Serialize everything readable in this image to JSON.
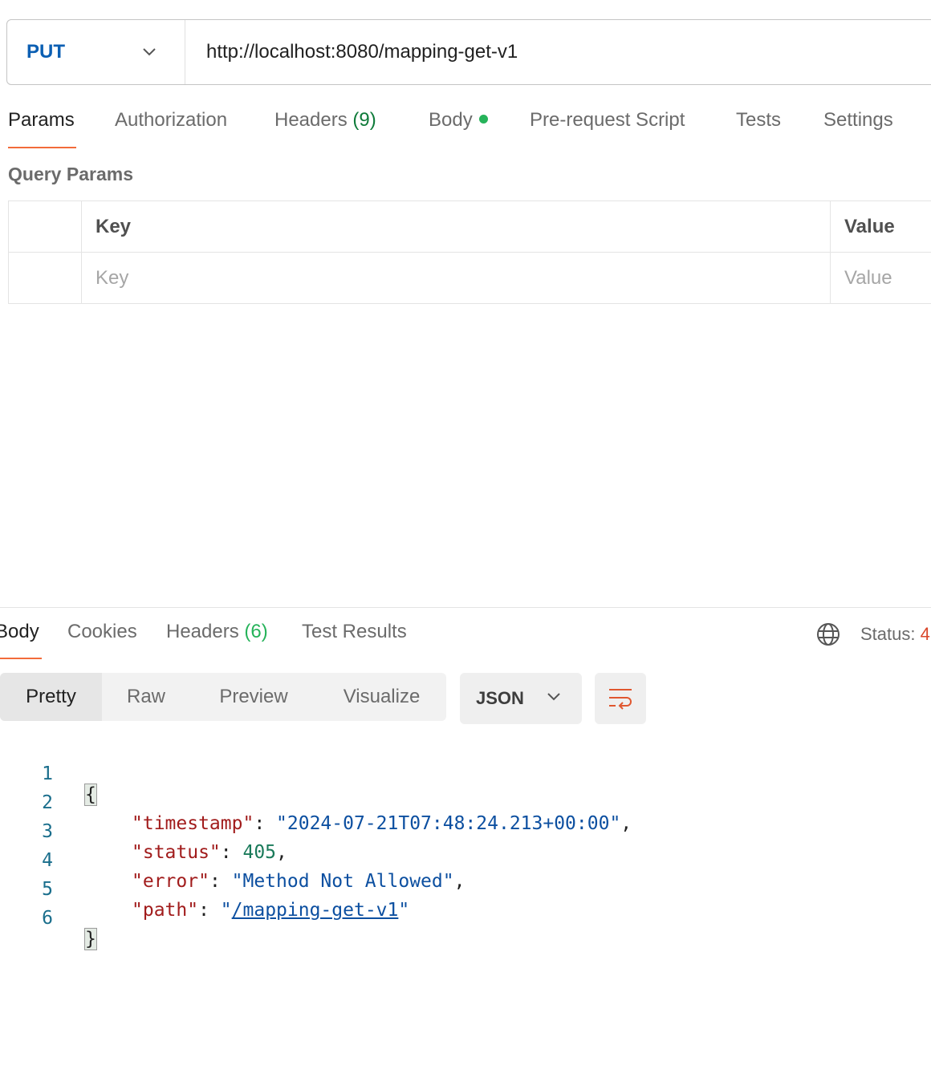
{
  "request": {
    "method": "PUT",
    "url": "http://localhost:8080/mapping-get-v1"
  },
  "request_tabs": {
    "params": "Params",
    "authorization": "Authorization",
    "headers_label": "Headers",
    "headers_count": "(9)",
    "body": "Body",
    "pre_request": "Pre-request Script",
    "tests": "Tests",
    "settings": "Settings"
  },
  "query_params": {
    "title": "Query Params",
    "columns": [
      "Key",
      "Value"
    ],
    "placeholder_key": "Key",
    "placeholder_value": "Value"
  },
  "response_tabs": {
    "body": "Body",
    "cookies": "Cookies",
    "headers_label": "Headers",
    "headers_count": "(6)",
    "test_results": "Test Results",
    "status_label": "Status:",
    "status_code": "4"
  },
  "view_modes": [
    "Pretty",
    "Raw",
    "Preview",
    "Visualize"
  ],
  "format": "JSON",
  "response_body": {
    "line_numbers": [
      "1",
      "2",
      "3",
      "4",
      "5",
      "6"
    ],
    "open_brace": "{",
    "close_brace": "}",
    "fields": [
      {
        "key": "\"timestamp\"",
        "value": "\"2024-07-21T07:48:24.213+00:00\"",
        "type": "string"
      },
      {
        "key": "\"status\"",
        "value": "405",
        "type": "number"
      },
      {
        "key": "\"error\"",
        "value": "\"Method Not Allowed\"",
        "type": "string"
      },
      {
        "key": "\"path\"",
        "value": "/mapping-get-v1",
        "type": "link"
      }
    ]
  },
  "colors": {
    "accent": "#f26b3a",
    "method": "#0b5fb3",
    "count": "#0f7b3a",
    "dot": "#26b35a",
    "json_key": "#a11c1c",
    "json_string": "#0c4fa0"
  }
}
